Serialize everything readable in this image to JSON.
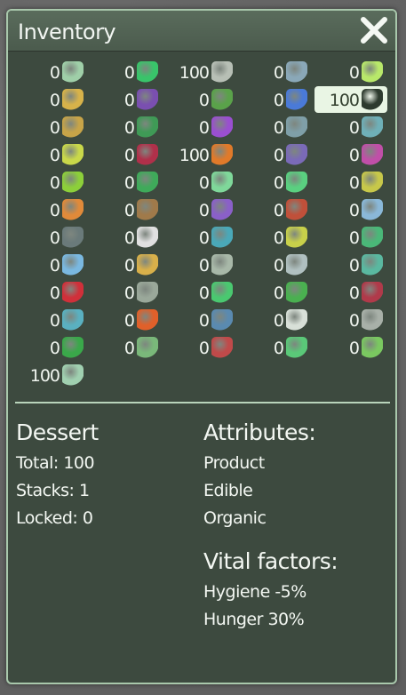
{
  "window": {
    "title": "Inventory"
  },
  "grid": {
    "rows": [
      [
        {
          "qty": "0",
          "icon": "potion-bottle-icon",
          "color": "#9fcfa8"
        },
        {
          "qty": "0",
          "icon": "coral-plant-icon",
          "color": "#39c46a"
        },
        {
          "qty": "100",
          "icon": "metal-bars-icon",
          "color": "#b7bfb5"
        },
        {
          "qty": "0",
          "icon": "flask-machine-icon",
          "color": "#8aa8b8"
        },
        {
          "qty": "0",
          "icon": "leaf-crystal-icon",
          "color": "#b8e86a"
        }
      ],
      [
        {
          "qty": "0",
          "icon": "crate-icon",
          "color": "#d7b24a"
        },
        {
          "qty": "0",
          "icon": "purple-crate-icon",
          "color": "#7a4fb0"
        },
        {
          "qty": "0",
          "icon": "beetle-icon",
          "color": "#5aa24a"
        },
        {
          "qty": "0",
          "icon": "molecule-icon",
          "color": "#4a7ad8"
        },
        {
          "qty": "100",
          "icon": "dessert-icon",
          "color": "#2d3a2e"
        }
      ],
      [
        {
          "qty": "0",
          "icon": "tea-cup-icon",
          "color": "#c7a448"
        },
        {
          "qty": "0",
          "icon": "book-icon",
          "color": "#3f9a56"
        },
        {
          "qty": "0",
          "icon": "tentacle-plant-icon",
          "color": "#9a4fd0"
        },
        {
          "qty": "0",
          "icon": "jar-icon",
          "color": "#7f9fa8"
        },
        {
          "qty": "0",
          "icon": "bottle-icon",
          "color": "#6fb0b8"
        }
      ],
      [
        {
          "qty": "0",
          "icon": "soup-bowl-icon",
          "color": "#c9d84a"
        },
        {
          "qty": "0",
          "icon": "wine-glass-icon",
          "color": "#b0304a"
        },
        {
          "qty": "100",
          "icon": "fruit-icon",
          "color": "#e07a2a"
        },
        {
          "qty": "0",
          "icon": "tablet-stack-icon",
          "color": "#7a6ab8"
        },
        {
          "qty": "0",
          "icon": "seaweed-icon",
          "color": "#c04fa8"
        }
      ],
      [
        {
          "qty": "0",
          "icon": "lime-icon",
          "color": "#8ccf3a"
        },
        {
          "qty": "0",
          "icon": "cactus-icon",
          "color": "#3faa5a"
        },
        {
          "qty": "0",
          "icon": "cloth-icon",
          "color": "#7fd89a"
        },
        {
          "qty": "0",
          "icon": "map-icon",
          "color": "#5ad080"
        },
        {
          "qty": "0",
          "icon": "lantern-icon",
          "color": "#c7c84a"
        }
      ],
      [
        {
          "qty": "0",
          "icon": "juice-cup-icon",
          "color": "#e08a3a"
        },
        {
          "qty": "0",
          "icon": "nest-icon",
          "color": "#a07a4a"
        },
        {
          "qty": "0",
          "icon": "box-icon",
          "color": "#8a60c8"
        },
        {
          "qty": "0",
          "icon": "steak-icon",
          "color": "#c0503a"
        },
        {
          "qty": "0",
          "icon": "particles-icon",
          "color": "#8ab8d8"
        }
      ],
      [
        {
          "qty": "0",
          "icon": "goggles-icon",
          "color": "#6a7a7a"
        },
        {
          "qty": "0",
          "icon": "bubble-bowl-icon",
          "color": "#e0e0e0"
        },
        {
          "qty": "0",
          "icon": "capsule-icon",
          "color": "#4aa8b8"
        },
        {
          "qty": "0",
          "icon": "seeds-icon",
          "color": "#c8d04a"
        },
        {
          "qty": "0",
          "icon": "vial-icon",
          "color": "#4ab878"
        }
      ],
      [
        {
          "qty": "0",
          "icon": "pill-icon",
          "color": "#7ab8e0"
        },
        {
          "qty": "0",
          "icon": "pizza-icon",
          "color": "#d8b04a"
        },
        {
          "qty": "0",
          "icon": "scroll-icon",
          "color": "#a8b8a8"
        },
        {
          "qty": "0",
          "icon": "shaker-icon",
          "color": "#b0c0c0"
        },
        {
          "qty": "0",
          "icon": "tray-icon",
          "color": "#5ab8a0"
        }
      ],
      [
        {
          "qty": "0",
          "icon": "berry-icon",
          "color": "#d0303a"
        },
        {
          "qty": "0",
          "icon": "shell-icon",
          "color": "#9aa89a"
        },
        {
          "qty": "0",
          "icon": "cup-icon",
          "color": "#4ac870"
        },
        {
          "qty": "0",
          "icon": "pod-icon",
          "color": "#4ab050"
        },
        {
          "qty": "0",
          "icon": "meat-icon",
          "color": "#b03a4a"
        }
      ],
      [
        {
          "qty": "0",
          "icon": "teapot-icon",
          "color": "#5ab0c0"
        },
        {
          "qty": "0",
          "icon": "spark-icon",
          "color": "#e0602a"
        },
        {
          "qty": "0",
          "icon": "monitor-icon",
          "color": "#5a8ab0"
        },
        {
          "qty": "0",
          "icon": "sushi-icon",
          "color": "#d8e0d8"
        },
        {
          "qty": "0",
          "icon": "bone-icon",
          "color": "#a8b0a8"
        }
      ],
      [
        {
          "qty": "0",
          "icon": "barrel-icon",
          "color": "#3aa84a"
        },
        {
          "qty": "0",
          "icon": "card-icon",
          "color": "#7ab87a"
        },
        {
          "qty": "0",
          "icon": "meat-bone-icon",
          "color": "#c04a4a"
        },
        {
          "qty": "0",
          "icon": "plate-icon",
          "color": "#5ac878"
        },
        {
          "qty": "0",
          "icon": "bottles-icon",
          "color": "#7ac860"
        }
      ],
      [
        {
          "qty": "100",
          "icon": "cans-icon",
          "color": "#a0d0b0"
        }
      ]
    ]
  },
  "details": {
    "name": "Dessert",
    "total": "Total: 100",
    "stacks": "Stacks: 1",
    "locked": "Locked: 0",
    "attributes_heading": "Attributes:",
    "attributes": [
      "Product",
      "Edible",
      "Organic"
    ],
    "vital_heading": "Vital factors:",
    "vital": [
      "Hygiene -5%",
      "Hunger 30%"
    ]
  }
}
